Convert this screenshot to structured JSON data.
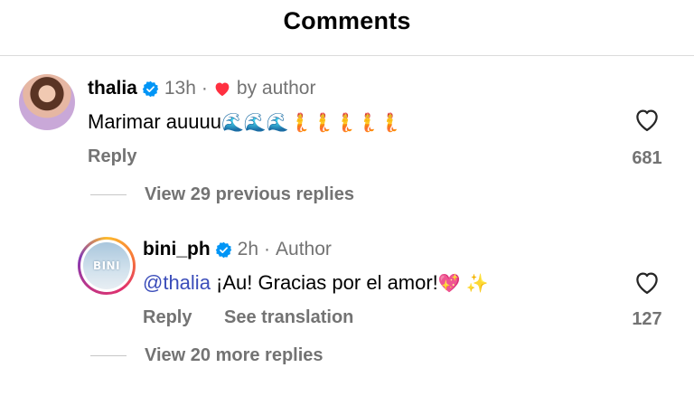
{
  "header": {
    "title": "Comments"
  },
  "comments": [
    {
      "username": "thalia",
      "time": "13h",
      "separator": "·",
      "author_like_text": "by author",
      "text": "Marimar auuuu",
      "emojis": [
        "🌊",
        "🌊",
        "🌊",
        "🧜",
        "🧜",
        "🧜",
        "🧜",
        "🧜"
      ],
      "reply_label": "Reply",
      "like_count": "681",
      "view_replies": "View 29 previous replies"
    },
    {
      "username": "bini_ph",
      "time": "2h",
      "separator": "·",
      "author_badge": "Author",
      "mention": "@thalia",
      "text": " ¡Au! Gracias por el amor!",
      "emojis": [
        "💖",
        "✨"
      ],
      "reply_label": "Reply",
      "translate_label": "See translation",
      "like_count": "127",
      "view_replies": "View 20 more replies"
    }
  ],
  "avatar_logo_text": "BINI",
  "colors": {
    "verified": "#0095f6",
    "heart": "#ff3040",
    "mention": "#3b4dba",
    "muted": "#737373"
  }
}
